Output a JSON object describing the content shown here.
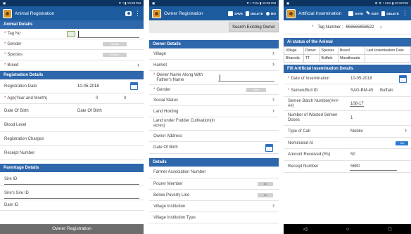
{
  "screen1": {
    "status": "▼ ⁴ ▮ 10:28 PM",
    "title": "Animal Registration",
    "sections": {
      "animal_details": "Animal Details",
      "registration_details": "Registration Details",
      "parentage_details": "Parentage Details"
    },
    "fields": {
      "tag_no": "Tag No",
      "gender": "Gender",
      "gender_pill": "Female",
      "species": "Species",
      "species_pill": "Buffalo",
      "breed": "Breed",
      "registration_date": "Registration Date",
      "registration_date_value": "10-05-2018",
      "age": "Age(Year and Month)",
      "age_year": "0",
      "age_month": "0",
      "date_of_birth": "Date Of Birth",
      "date_of_birth_value": "Date Of Birth",
      "blood_level": "Blood Level",
      "registration_charges": "Registration Charges",
      "receipt_number": "Receipt Number",
      "sire_id": "Sire ID",
      "sires_sire_id": "Sire's Sire ID",
      "dam_id": "Dam ID"
    },
    "bottom_button": "Owner Registration"
  },
  "screen2": {
    "status": "▼ ⁴ 71% ▮ 10:28 PM",
    "title": "Owner Registration",
    "actions": {
      "save": "SAVE",
      "delete": "DELETE",
      "more": "MO"
    },
    "search_button": "Search Existing Owner",
    "sections": {
      "owner_details": "Owner Details",
      "details": "Details"
    },
    "fields": {
      "village": "Village",
      "hamlet": "Hamlet",
      "owner_name": "Owner Name Along With Father's Name",
      "gender": "Gender",
      "gender_pill": "Male",
      "social_status": "Social Status",
      "land_holding": "Land Holding",
      "land_fodder": "Land under Fodder Cultivation(in acres)",
      "owner_address": "Owner Address",
      "date_of_birth": "Date Of Birth",
      "farmer_association": "Farmer Association Number",
      "pourer_member": "Pourer Member",
      "pourer_toggle": "No",
      "below_poverty": "Below Poverty Line",
      "below_poverty_toggle": "No",
      "village_institution": "Village Institution",
      "village_institution_type": "Village Institution Type"
    }
  },
  "screen3": {
    "status": "⚙ ▼ ⁴ 14% ▮ 10:28 PM",
    "title": "Artificial Insemination",
    "actions": {
      "save": "SAVE",
      "edit": "EDIT",
      "delete": "DELETE"
    },
    "tag_label": "Tag Number :",
    "tag_value": "656565656522",
    "sections": {
      "ai_status": "AI status of the Animal",
      "fill_ai": "Fill Artificial Insemination Details"
    },
    "table": {
      "headers": [
        "Village",
        "Owner",
        "Species",
        "Breed",
        "Last Insemination Date"
      ],
      "row": [
        "Bharoda",
        "TT",
        "Buffalo",
        "Marathwada",
        ""
      ]
    },
    "fields": {
      "date_of_insemination": "Date of Insemination",
      "date_of_insemination_value": "10-05-2018",
      "semen_bull_id": "Semen/Bull ID",
      "semen_bull_id_value": "SAG-BM-45",
      "semen_bull_species": "Buffalo",
      "semen_batch": "Semen Batch Number(###-##)",
      "semen_batch_value": "108-17",
      "wasted_doses": "Number of Wasted Semen Doses",
      "wasted_doses_value": "1",
      "type_of_call": "Type of Call",
      "type_of_call_value": "Mobile",
      "nominated_ai": "Nominated AI",
      "nominated_toggle": "Yes",
      "amount_received": "Amount Received (Rs)",
      "amount_received_value": "50",
      "receipt_number": "Receipt Number",
      "receipt_number_value": "5680"
    },
    "nav": {
      "back": "◁",
      "home": "○",
      "recent": "□"
    }
  }
}
